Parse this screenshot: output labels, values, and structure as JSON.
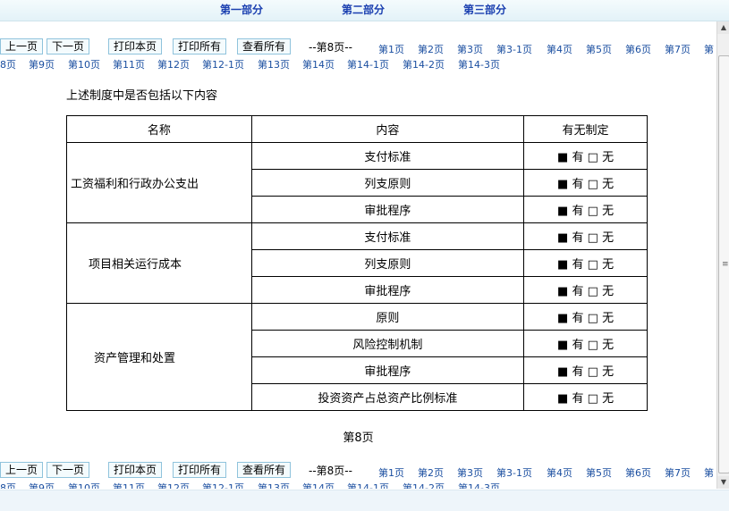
{
  "sections": [
    "第一部分",
    "第二部分",
    "第三部分"
  ],
  "nav": {
    "prev": "上一页",
    "next": "下一页",
    "print_page": "打印本页",
    "print_all": "打印所有",
    "view_all": "查看所有",
    "current": "--第8页--",
    "row1_links": [
      "第1页",
      "第2页",
      "第3页",
      "第3-1页",
      "第4页",
      "第5页",
      "第6页",
      "第7页",
      "第"
    ],
    "row2_links": [
      "8页",
      "第9页",
      "第10页",
      "第11页",
      "第12页",
      "第12-1页",
      "第13页",
      "第14页",
      "第14-1页",
      "第14-2页",
      "第14-3页"
    ]
  },
  "question": "上述制度中是否包括以下内容",
  "table": {
    "headers": [
      "名称",
      "内容",
      "有无制定"
    ],
    "groups": [
      {
        "category": "工资福利和行政办公支出",
        "items": [
          "支付标准",
          "列支原则",
          "审批程序"
        ]
      },
      {
        "category": "项目相关运行成本",
        "items": [
          "支付标准",
          "列支原则",
          "审批程序"
        ]
      },
      {
        "category": "资产管理和处置",
        "items": [
          "原则",
          "风险控制机制",
          "审批程序",
          "投资资产占总资产比例标准"
        ]
      }
    ],
    "checked_box": "■",
    "unchecked_box": "□",
    "yes_label": "有",
    "no_label": "无"
  },
  "page_label": "第8页"
}
